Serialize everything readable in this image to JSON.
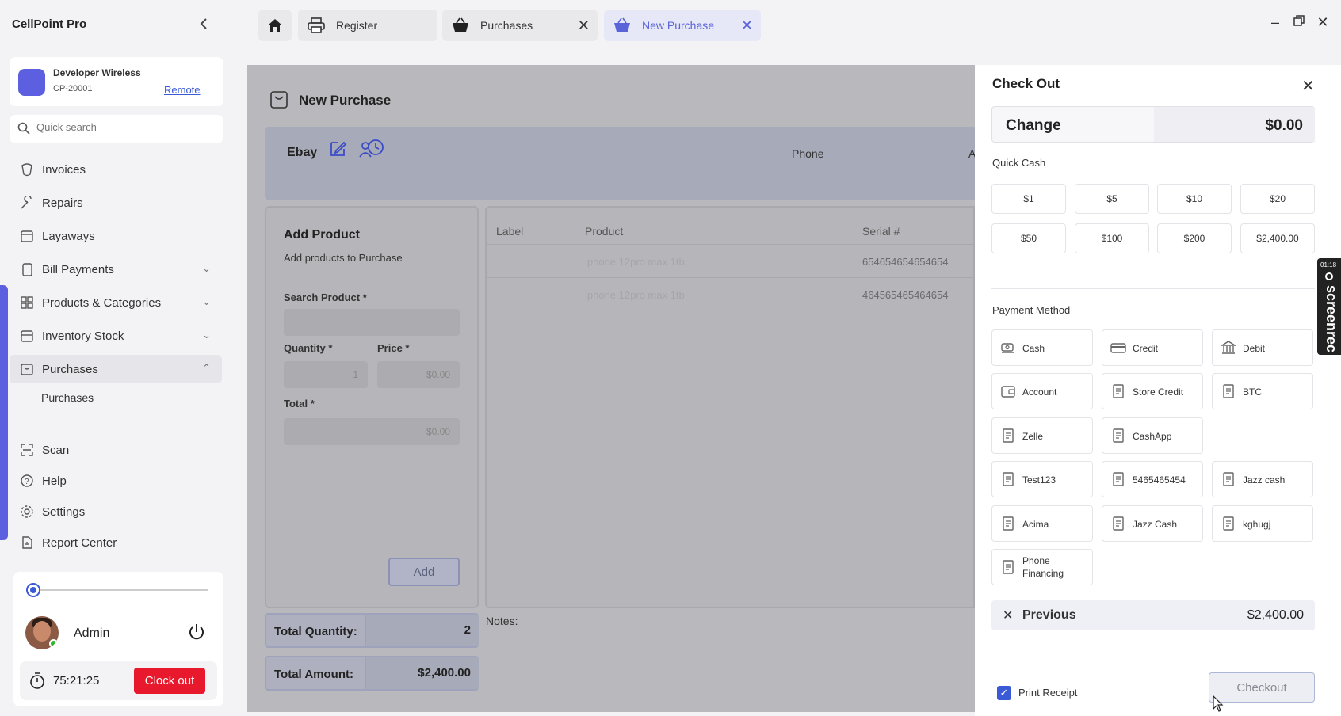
{
  "app": {
    "title": "CellPoint Pro"
  },
  "tabs": [
    {
      "label": "Register",
      "icon": "printer-icon"
    },
    {
      "label": "Purchases",
      "icon": "basket-icon"
    },
    {
      "label": "New Purchase",
      "icon": "basket-icon"
    }
  ],
  "store": {
    "name": "Developer Wireless",
    "id": "CP-20001",
    "mode_link": "Remote"
  },
  "search": {
    "placeholder": "Quick search"
  },
  "sidebar": {
    "items": [
      {
        "label": "Invoices",
        "icon": "invoice-icon"
      },
      {
        "label": "Repairs",
        "icon": "wrench-icon"
      },
      {
        "label": "Layaways",
        "icon": "calendar-icon"
      },
      {
        "label": "Bill Payments",
        "icon": "bill-icon"
      },
      {
        "label": "Products & Categories",
        "icon": "categories-icon"
      },
      {
        "label": "Inventory Stock",
        "icon": "box-icon"
      },
      {
        "label": "Purchases",
        "icon": "basket-icon"
      },
      {
        "label": "Scan",
        "icon": "scan-icon"
      },
      {
        "label": "Help",
        "icon": "help-icon"
      },
      {
        "label": "Settings",
        "icon": "gear-icon"
      },
      {
        "label": "Report Center",
        "icon": "report-icon"
      }
    ],
    "sub_items": [
      "Purchases"
    ]
  },
  "user": {
    "name": "Admin",
    "timer": "75:21:25",
    "clock_out_label": "Clock out"
  },
  "new_purchase": {
    "title": "New Purchase",
    "vendor": "Ebay",
    "phone_label": "Phone",
    "next_col_fragment": "A"
  },
  "add_product": {
    "title": "Add Product",
    "subtitle": "Add products to Purchase",
    "search_label": "Search Product *",
    "quantity_label": "Quantity *",
    "quantity_value": "1",
    "price_label": "Price *",
    "price_value": "$0.00",
    "total_label": "Total *",
    "total_value": "$0.00",
    "add_label": "Add"
  },
  "items_table": {
    "headers": [
      "Label",
      "Product",
      "Serial #"
    ],
    "rows": [
      {
        "label": "",
        "product": "iphone 12pro max 1tb",
        "serial": "654654654654654"
      },
      {
        "label": "",
        "product": "iphone 12pro max 1tb",
        "serial": "464565465464654"
      }
    ]
  },
  "totals": {
    "quantity_label": "Total Quantity:",
    "quantity_value": "2",
    "amount_label": "Total Amount:",
    "amount_value": "$2,400.00"
  },
  "notes_label": "Notes:",
  "checkout": {
    "title": "Check Out",
    "change_label": "Change",
    "change_value": "$0.00",
    "quick_cash_label": "Quick Cash",
    "quick_cash": [
      "$1",
      "$5",
      "$10",
      "$20",
      "$50",
      "$100",
      "$200",
      "$2,400.00"
    ],
    "payment_method_label": "Payment Method",
    "payment_methods": [
      {
        "label": "Cash",
        "icon": "cash-icon"
      },
      {
        "label": "Credit",
        "icon": "credit-card-icon"
      },
      {
        "label": "Debit",
        "icon": "bank-icon"
      },
      {
        "label": "Account",
        "icon": "wallet-icon"
      },
      {
        "label": "Store Credit",
        "icon": "receipt-icon"
      },
      {
        "label": "BTC",
        "icon": "receipt-icon"
      },
      {
        "label": "Zelle",
        "icon": "receipt-icon"
      },
      {
        "label": "CashApp",
        "icon": "receipt-icon"
      },
      {
        "label": "Test123",
        "icon": "receipt-icon"
      },
      {
        "label": "5465465454",
        "icon": "receipt-icon"
      },
      {
        "label": "Jazz cash",
        "icon": "receipt-icon"
      },
      {
        "label": "Acima",
        "icon": "receipt-icon"
      },
      {
        "label": "Jazz Cash",
        "icon": "receipt-icon"
      },
      {
        "label": "kghugj",
        "icon": "receipt-icon"
      },
      {
        "label": "Phone Financing",
        "icon": "receipt-icon"
      }
    ],
    "previous_label": "Previous",
    "previous_value": "$2,400.00",
    "print_receipt_label": "Print Receipt",
    "print_receipt_checked": true,
    "checkout_label": "Checkout"
  },
  "screen_recorder": {
    "time": "01:18",
    "label": "screenrec"
  },
  "colors": {
    "accent": "#5b5fe0",
    "link": "#3b5bd6",
    "danger": "#e8192c"
  }
}
